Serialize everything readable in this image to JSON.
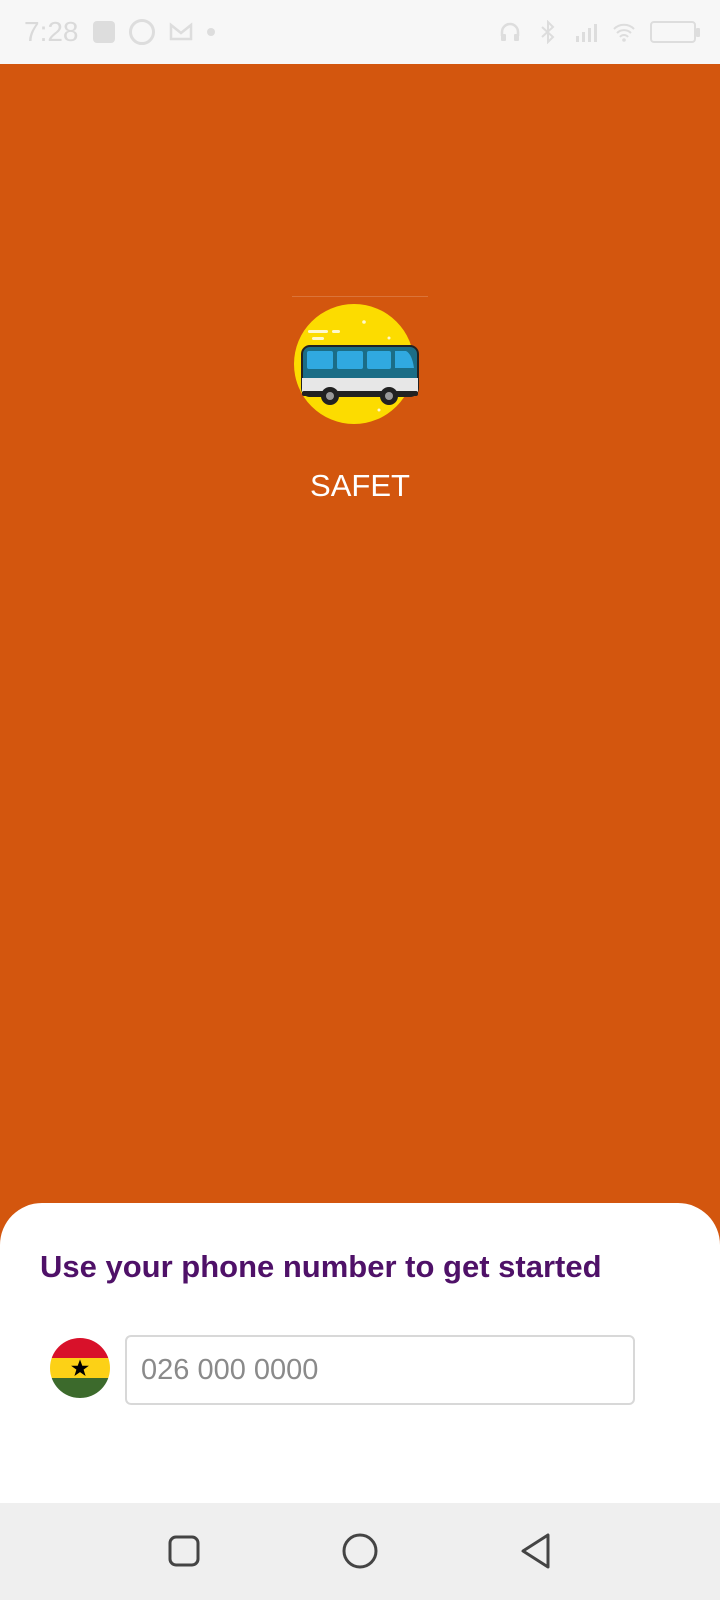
{
  "status_bar": {
    "time": "7:28",
    "icons": [
      "notification-icon",
      "whatsapp-icon",
      "gmail-icon",
      "dot-icon",
      "headset-icon",
      "bluetooth-icon",
      "signal-icon",
      "wifi-icon",
      "battery-icon"
    ]
  },
  "app": {
    "name": "SAFET",
    "logo_icon": "bus-icon",
    "colors": {
      "background": "#d3560e",
      "logo_circle": "#fcdc00",
      "bus_body": "#1b6d86",
      "title": "#4f1168"
    }
  },
  "sheet": {
    "title": "Use your phone number to get started",
    "country_flag": "ghana-flag-icon",
    "phone": {
      "placeholder": "026 000 0000",
      "value": ""
    }
  },
  "nav_bar": {
    "buttons": [
      "recents-button",
      "home-button",
      "back-button"
    ]
  }
}
